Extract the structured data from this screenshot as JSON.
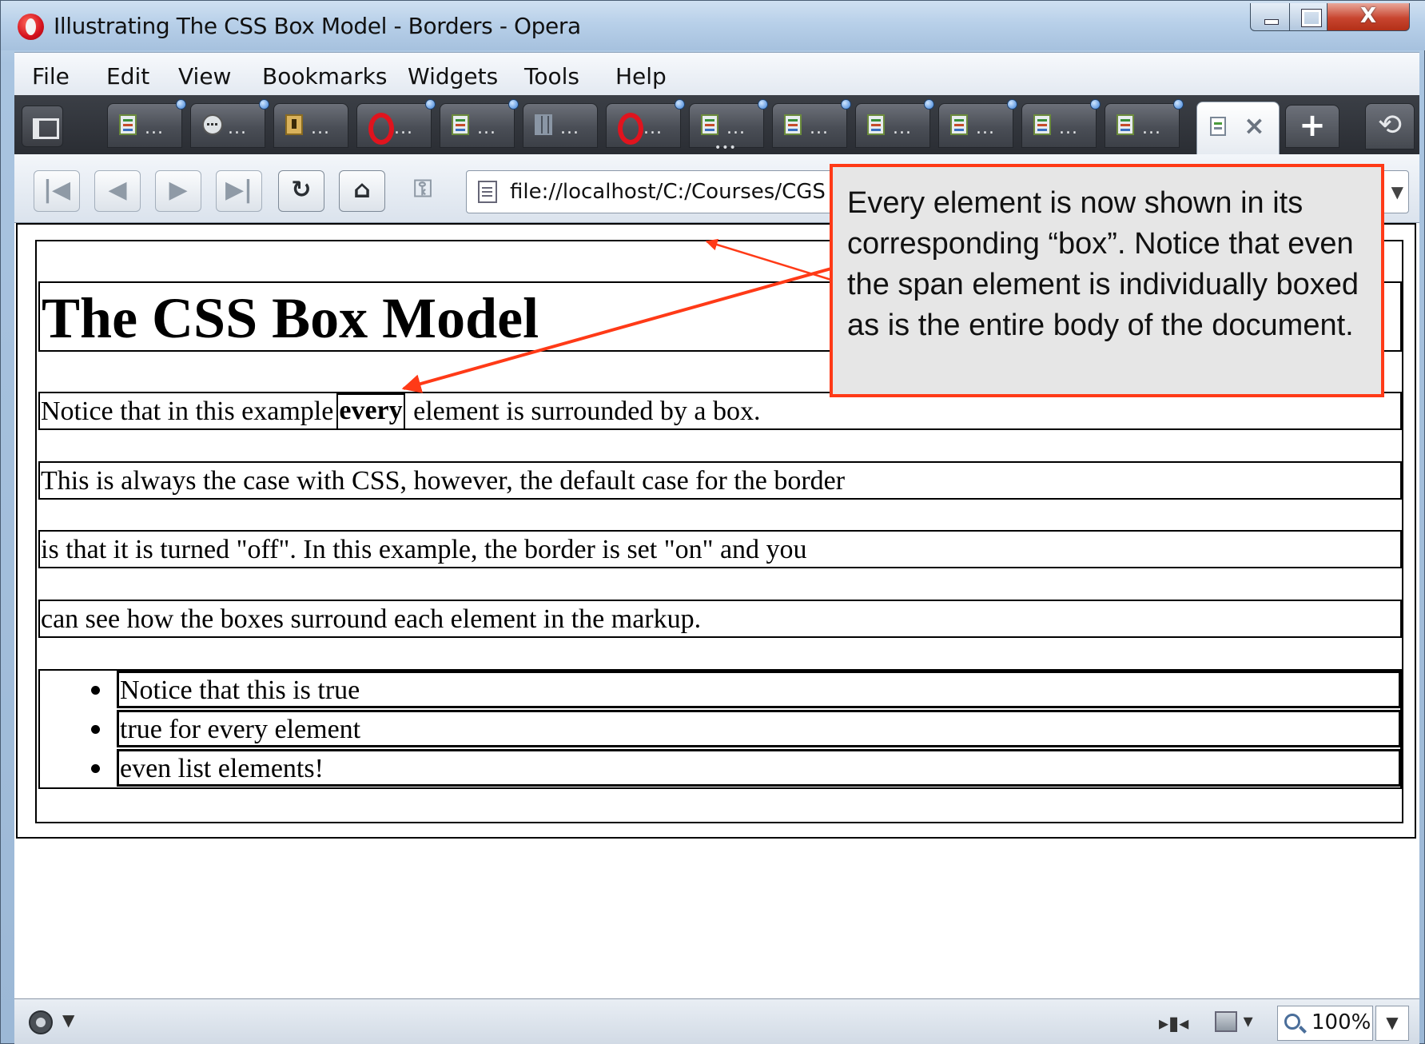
{
  "window": {
    "title": "Illustrating The CSS Box Model - Borders - Opera",
    "close_glyph": "X"
  },
  "menu": {
    "items": [
      "File",
      "Edit",
      "View",
      "Bookmarks",
      "Widgets",
      "Tools",
      "Help"
    ]
  },
  "tabs": {
    "ellipsis": "...",
    "more_indicator": "•••",
    "new_tab_glyph": "+",
    "close_glyph": "×",
    "trash_glyph": "⟲"
  },
  "navigation": {
    "first_glyph": "|◀",
    "back_glyph": "◀",
    "forward_glyph": "▶",
    "last_glyph": "▶|",
    "reload_glyph": "↻",
    "home_glyph": "⌂",
    "key_glyph": "⚿",
    "address": "file://localhost/C:/Courses/CGS",
    "address_dropdown_glyph": "▼"
  },
  "page": {
    "heading": "The CSS Box Model",
    "p1_before": "Notice that in this example",
    "p1_span": "every",
    "p1_after": "element is surrounded by a box.",
    "p2": "This is always the case with CSS, however, the default case for the border",
    "p3": "is that it is turned \"off\". In this example, the border is set \"on\" and you",
    "p4": "can see how the boxes surround each element in the markup.",
    "list_items": [
      "Notice that this is true",
      "true for every element",
      "even list elements!"
    ]
  },
  "callout": {
    "text": "Every element is now shown in its corresponding “box”.  Notice that even the span element is individually boxed as is the entire body of the document.",
    "border_color": "#ff3a17",
    "arrow_color": "#ff3a17"
  },
  "status": {
    "zoom": "100%",
    "dropdown_glyph": "▼"
  }
}
